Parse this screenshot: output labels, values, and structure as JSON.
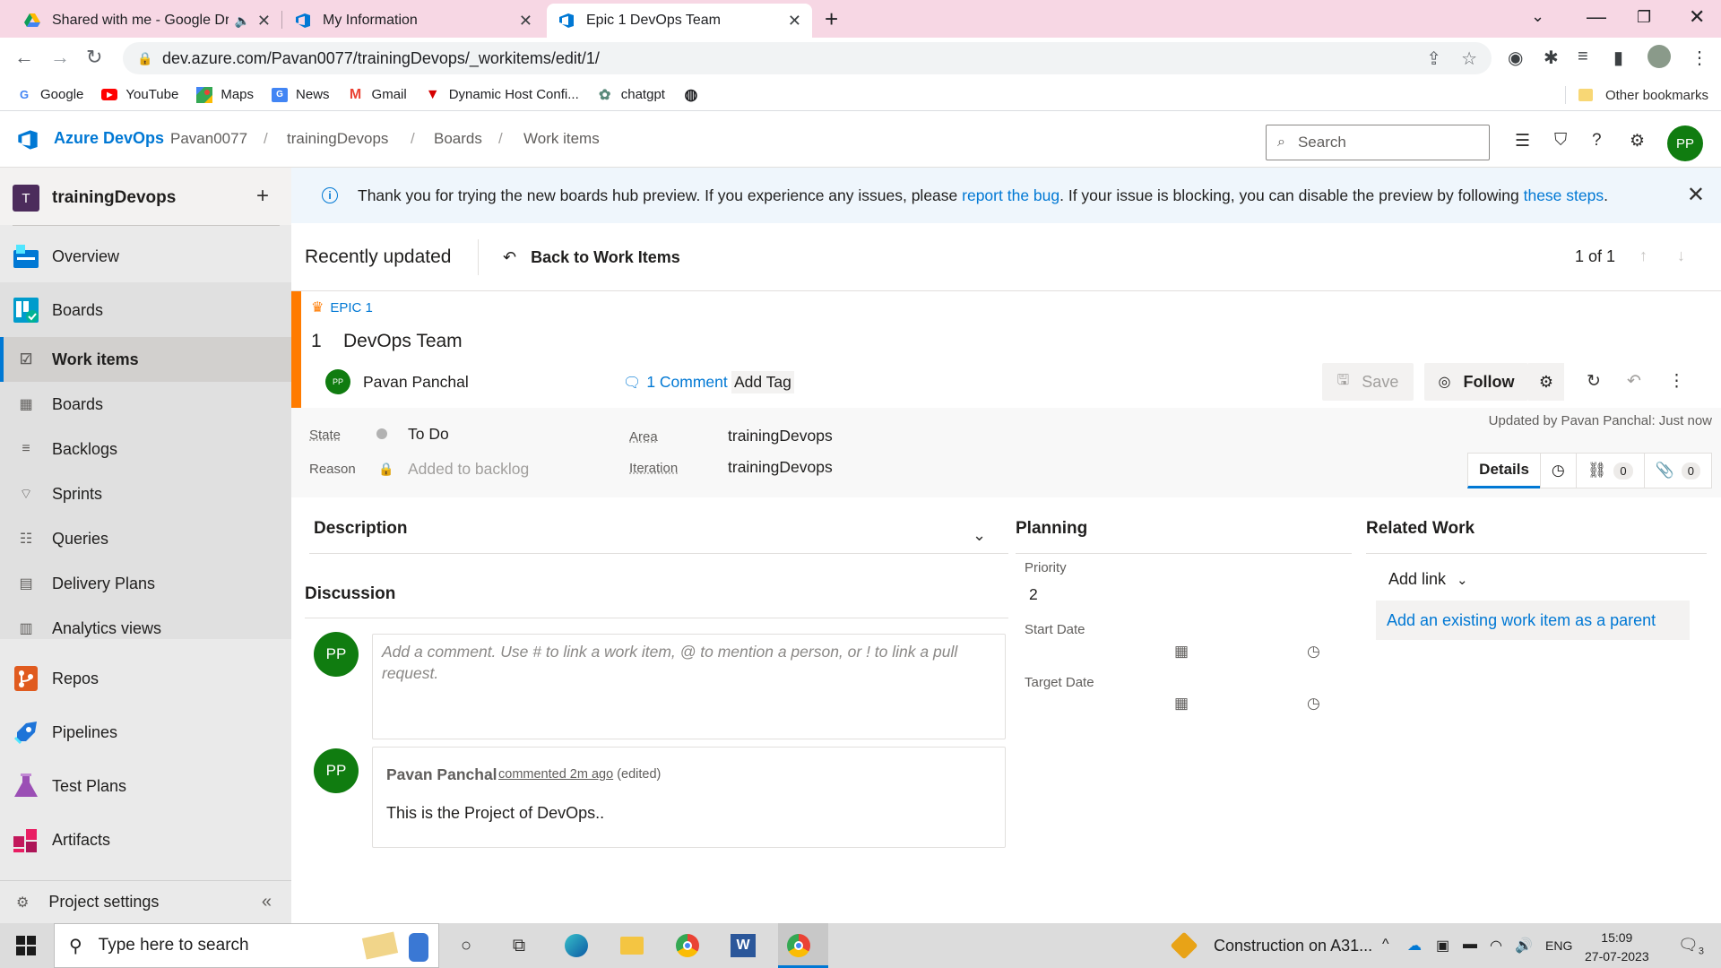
{
  "browser": {
    "tabs": [
      {
        "title": "Shared with me - Google Dri",
        "icon": "google-drive-icon"
      },
      {
        "title": "My Information",
        "icon": "azure-devops-icon"
      },
      {
        "title": "Epic 1 DevOps Team",
        "icon": "azure-devops-icon"
      }
    ],
    "url": "dev.azure.com/Pavan0077/trainingDevops/_workitems/edit/1/",
    "bookmarks": [
      "Google",
      "YouTube",
      "Maps",
      "News",
      "Gmail",
      "Dynamic Host Confi...",
      "chatgpt"
    ],
    "other_bookmarks": "Other bookmarks"
  },
  "header": {
    "brand": "Azure DevOps",
    "breadcrumbs": [
      "Pavan0077",
      "trainingDevops",
      "Boards",
      "Work items"
    ],
    "search_placeholder": "Search",
    "user_initials": "PP"
  },
  "sidebar": {
    "project_initial": "T",
    "project_name": "trainingDevops",
    "items": {
      "overview": "Overview",
      "boards": "Boards",
      "work_items": "Work items",
      "boards_sub": "Boards",
      "backlogs": "Backlogs",
      "sprints": "Sprints",
      "queries": "Queries",
      "delivery_plans": "Delivery Plans",
      "analytics_views": "Analytics views",
      "repos": "Repos",
      "pipelines": "Pipelines",
      "test_plans": "Test Plans",
      "artifacts": "Artifacts"
    },
    "project_settings": "Project settings"
  },
  "banner": {
    "text_1": "Thank you for trying the new boards hub preview. If you experience any issues, please ",
    "link_1": "report the bug",
    "text_2": ". If your issue is blocking, you can disable the preview by following ",
    "link_2": "these steps",
    "text_3": "."
  },
  "subheader": {
    "recent": "Recently updated",
    "back": "Back to Work Items",
    "pager": "1 of 1"
  },
  "work_item": {
    "type": "EPIC 1",
    "id": "1",
    "title": "DevOps Team",
    "assignee": "Pavan Panchal",
    "assignee_initials": "PP",
    "comments": "1 Comment",
    "add_tag": "Add Tag",
    "save": "Save",
    "follow": "Follow",
    "updated_by": "Updated by Pavan Panchal: Just now",
    "state_label": "State",
    "state_value": "To Do",
    "reason_label": "Reason",
    "reason_value": "Added to backlog",
    "area_label": "Area",
    "area_value": "trainingDevops",
    "iteration_label": "Iteration",
    "iteration_value": "trainingDevops",
    "tabs": {
      "details": "Details",
      "links_count": "0",
      "attachments_count": "0"
    }
  },
  "description": {
    "title": "Description"
  },
  "discussion": {
    "title": "Discussion",
    "placeholder": "Add a comment. Use # to link a work item, @ to mention a person, or ! to link a pull request.",
    "comment": {
      "author": "Pavan Panchal",
      "action": "commented 2m ago",
      "edited": "(edited)",
      "text": "This is the Project of DevOps.."
    }
  },
  "planning": {
    "title": "Planning",
    "priority_label": "Priority",
    "priority_value": "2",
    "start_label": "Start Date",
    "target_label": "Target Date"
  },
  "related": {
    "title": "Related Work",
    "add_link": "Add link",
    "parent_link": "Add an existing work item as a parent"
  },
  "taskbar": {
    "search": "Type here to search",
    "weather": "Construction on A31...",
    "lang": "ENG",
    "time": "15:09",
    "date": "27-07-2023",
    "notifications": "3"
  },
  "colors": {
    "accent": "#0078d4",
    "epic": "#ff7b00",
    "avatar": "#107c10",
    "project_badge": "#4c2c5c"
  }
}
